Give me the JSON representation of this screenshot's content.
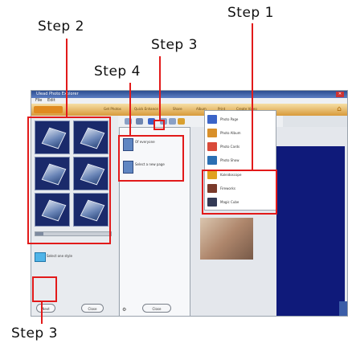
{
  "annotations": {
    "step1_top": "Step 1",
    "step2": "Step 2",
    "step3_top": "Step 3",
    "step4": "Step 4",
    "step3_bottom": "Step 3",
    "highlight_color": "#e21a1a"
  },
  "app": {
    "title": "Ulead Photo Explorer",
    "menu": [
      "File",
      "Edit"
    ],
    "nav_tabs": [
      "Get Photos",
      "Quick Enhance",
      "Share",
      "Album",
      "Print",
      "Create Video"
    ],
    "home_icon": "home-icon"
  },
  "left_panel": {
    "thumbnails": [
      "cube-1",
      "cube-2",
      "cube-3",
      "cube-4",
      "cube-5",
      "cube-6"
    ],
    "style_option_label": "Select one style",
    "next_label": "Next",
    "close_label": "Close"
  },
  "dropdown": {
    "items": [
      {
        "label": "Of everyone"
      },
      {
        "label": "Select a new page"
      }
    ],
    "close_label": "Close"
  },
  "creative_menu": {
    "items": [
      {
        "label": "Photo Page",
        "color": "#3b64c8"
      },
      {
        "label": "Photo Album",
        "color": "#d9902a"
      },
      {
        "label": "Photo Cards",
        "color": "#d94a3a"
      },
      {
        "label": "Photo Show",
        "color": "#2a6fb3"
      },
      {
        "label": "Kaleidoscope",
        "color": "#e0a020"
      },
      {
        "label": "Fireworks",
        "color": "#7a3a2a"
      },
      {
        "label": "Magic Cube",
        "color": "#333a55"
      }
    ]
  }
}
